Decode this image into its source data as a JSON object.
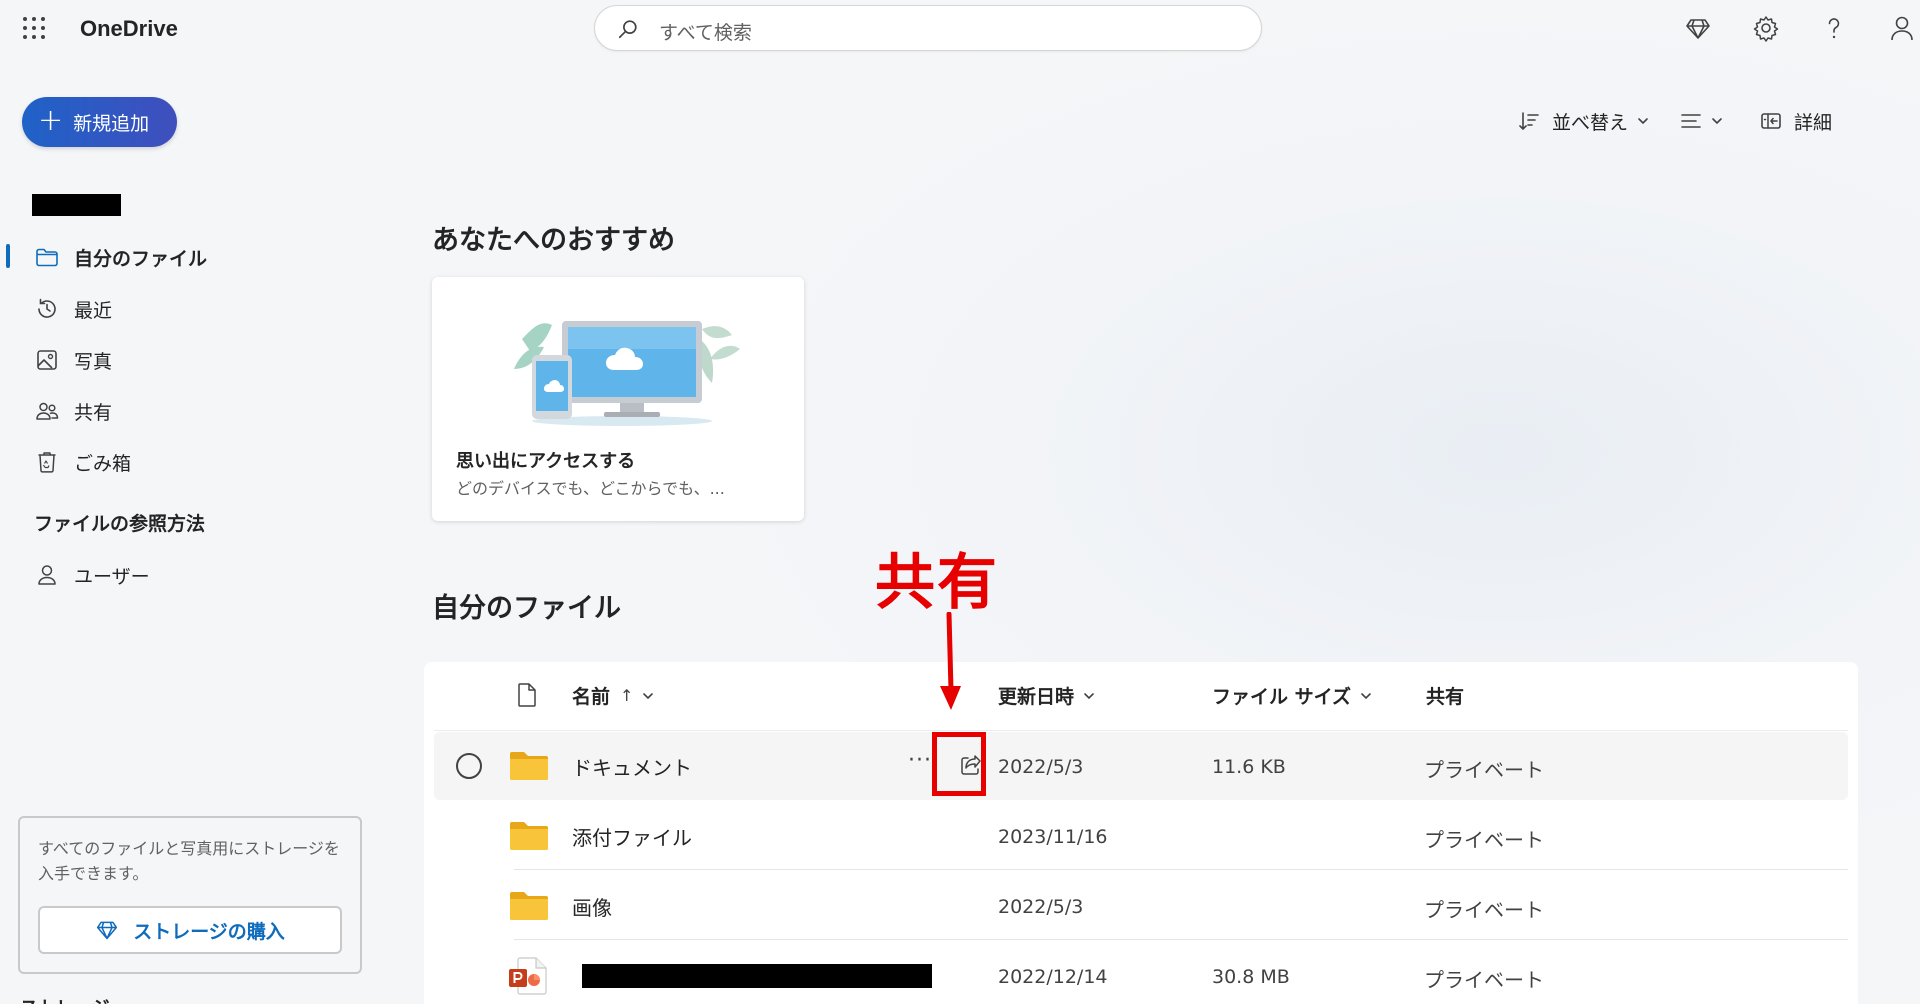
{
  "header": {
    "app_title": "OneDrive",
    "search_placeholder": "すべて検索"
  },
  "sidebar": {
    "new_button": "新規追加",
    "nav_items": [
      {
        "label": "自分のファイル",
        "icon": "folder-icon",
        "active": true
      },
      {
        "label": "最近",
        "icon": "history-icon"
      },
      {
        "label": "写真",
        "icon": "photo-icon"
      },
      {
        "label": "共有",
        "icon": "people-icon"
      },
      {
        "label": "ごみ箱",
        "icon": "recycle-bin-icon"
      }
    ],
    "browse_heading": "ファイルの参照方法",
    "browse_items": [
      {
        "label": "ユーザー",
        "icon": "person-icon"
      }
    ],
    "storage_text": "すべてのファイルと写真用にストレージを入手できます。",
    "storage_button": "ストレージの購入",
    "cut_off_label": "ストレージ"
  },
  "toolbar": {
    "sort_label": "並べ替え",
    "details_label": "詳細"
  },
  "recommended": {
    "heading": "あなたへのおすすめ",
    "card_title": "思い出にアクセスする",
    "card_subtitle": "どのデバイスでも、どこからでも、..."
  },
  "files": {
    "heading": "自分のファイル",
    "columns": {
      "name": "名前",
      "name_sort": "↑",
      "modified": "更新日時",
      "size": "ファイル サイズ",
      "sharing": "共有"
    },
    "rows": [
      {
        "name": "ドキュメント",
        "type": "folder",
        "modified": "2022/5/3",
        "size": "11.6 KB",
        "sharing": "プライベート",
        "hover": true
      },
      {
        "name": "添付ファイル",
        "type": "folder",
        "modified": "2023/11/16",
        "size": "",
        "sharing": "プライベート"
      },
      {
        "name": "画像",
        "type": "folder",
        "modified": "2022/5/3",
        "size": "",
        "sharing": "プライベート"
      },
      {
        "name": "",
        "type": "powerpoint",
        "modified": "2022/12/14",
        "size": "30.8 MB",
        "sharing": "プライベート",
        "redacted": true
      }
    ]
  },
  "annotation": {
    "label": "共有",
    "color": "#e60000"
  },
  "colors": {
    "accent": "#0f6cbd",
    "folder": "#f8c53a",
    "powerpoint": "#c43e1c"
  }
}
